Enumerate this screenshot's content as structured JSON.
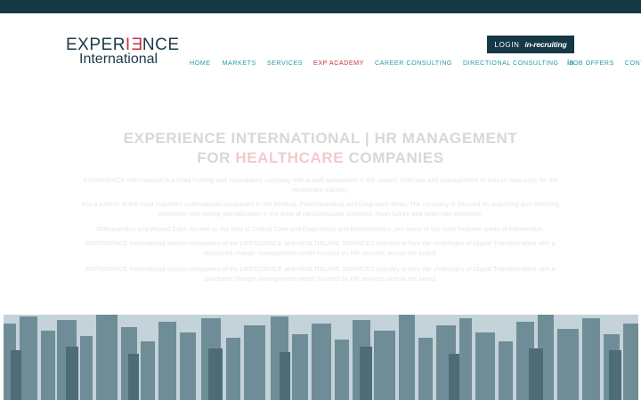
{
  "logo": {
    "line1": "EXPERIENCE",
    "line2": "International"
  },
  "login": {
    "label": "LOGIN",
    "brand": "in-recruiting"
  },
  "nav": [
    {
      "label": "HOME",
      "active": false
    },
    {
      "label": "MARKETS",
      "active": false
    },
    {
      "label": "SERVICES",
      "active": false
    },
    {
      "label": "EXP ACADEMY",
      "active": true
    },
    {
      "label": "CAREER CONSULTING",
      "active": false
    },
    {
      "label": "DIRECTIONAL CONSULTING",
      "active": false
    },
    {
      "label": "JOB OFFERS",
      "active": false
    },
    {
      "label": "CONTACT",
      "active": false
    }
  ],
  "social": {
    "linkedin": "in"
  },
  "hero": {
    "line1": "EXPERIENCE INTERNATIONAL | HR MANAGEMENT",
    "line2_pre": "FOR ",
    "line2_highlight": "HEALTHCARE",
    "line2_post": " COMPANIES"
  },
  "paragraphs": {
    "p1": "EXPERIENCE International is a head hunting and consultancy company with a staff specialized in the search, selection and management of human resources for the Healthcare industry.",
    "p2": "It is a partner of the most important multinational companies in the Medical, Pharmaceutical and Diagnostic fields. The company is focused on searching and selecting personnel with strong specialization in the area of cardiovascular diseases, heart failure and heart rate problems.",
    "p3": "Orthopaedics and Wound Care, as well as the field of Critical Care and Diagnostics and Bioinformatics, are some of our most frequent areas of intervention.",
    "p4": "EXPERIENCE International assists companies of the LIFESCIENCE and HEALTHCARE SERVICES industry to face the challenges of Digital Transformation with a structured change management model focused on HR services across the board.",
    "p5": "EXPERIENCE International assists companies of the LIFESCIENCE and HEALTHCARE SERVICES industry to face the challenges of Digital Transformation with a structured change management model focused on HR services across the board."
  },
  "colors": {
    "dark": "#163746",
    "teal": "#2a9aa6",
    "accent": "#c8323c"
  }
}
